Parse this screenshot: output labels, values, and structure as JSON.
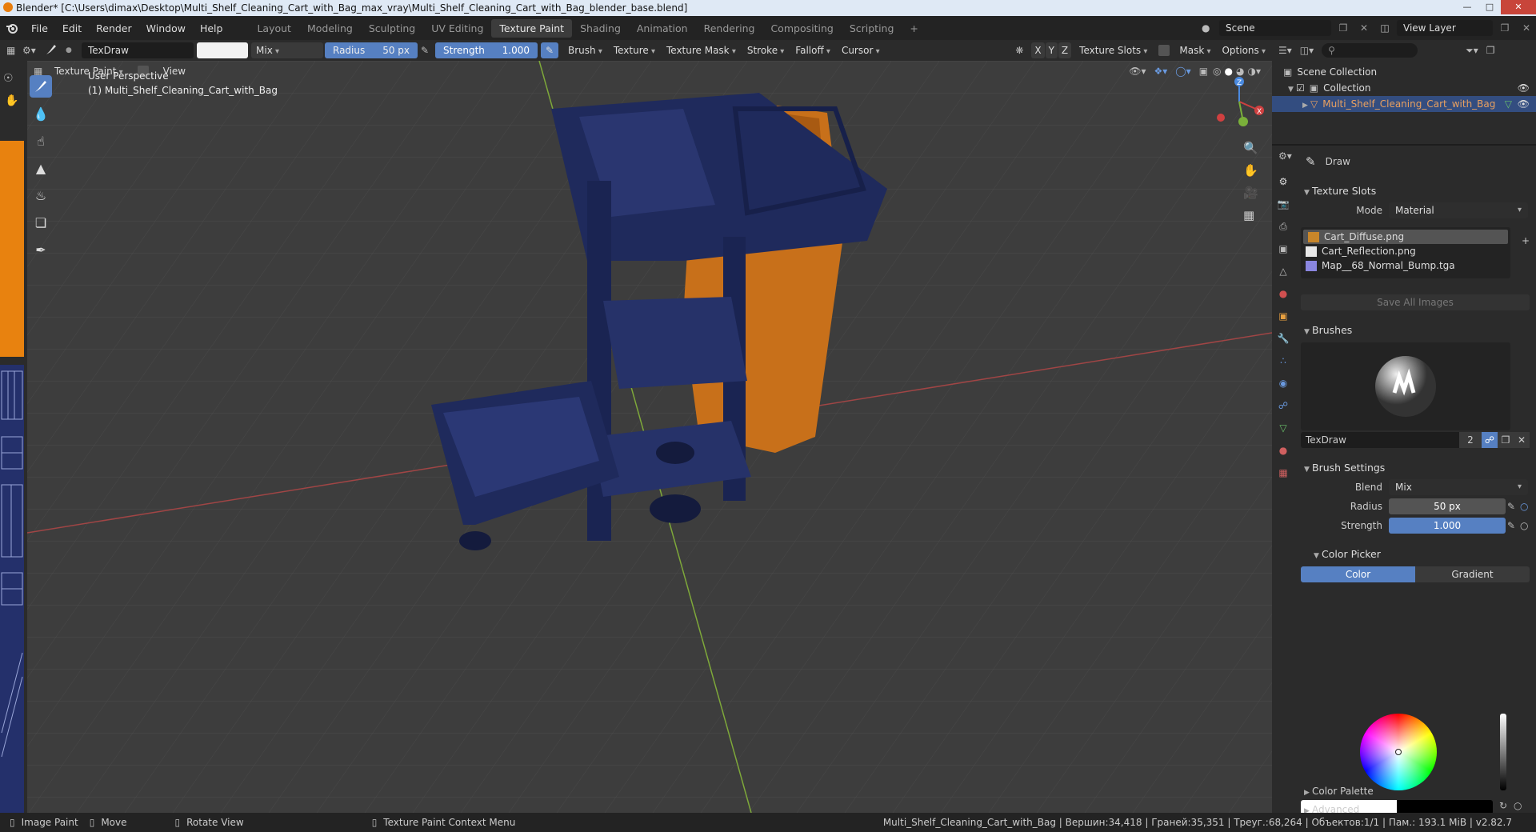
{
  "titlebar": {
    "title": "Blender* [C:\\Users\\dimax\\Desktop\\Multi_Shelf_Cleaning_Cart_with_Bag_max_vray\\Multi_Shelf_Cleaning_Cart_with_Bag_blender_base.blend]"
  },
  "menu": [
    "File",
    "Edit",
    "Render",
    "Window",
    "Help"
  ],
  "workspaces": [
    "Layout",
    "Modeling",
    "Sculpting",
    "UV Editing",
    "Texture Paint",
    "Shading",
    "Animation",
    "Rendering",
    "Compositing",
    "Scripting"
  ],
  "active_workspace": "Texture Paint",
  "scene": {
    "label": "Scene",
    "view_layer": "View Layer"
  },
  "header": {
    "brush_name": "TexDraw",
    "blend": "Mix",
    "radius_label": "Radius",
    "radius_value": "50 px",
    "strength_label": "Strength",
    "strength_value": "1.000",
    "strength_fraction": 1.0,
    "menus": [
      "Brush",
      "Texture",
      "Texture Mask",
      "Stroke",
      "Falloff",
      "Cursor"
    ],
    "axes": [
      "X",
      "Y",
      "Z"
    ],
    "texture_slots": "Texture Slots",
    "mask": "Mask",
    "options": "Options",
    "mode": "Texture Paint",
    "view": "View"
  },
  "viewport": {
    "perspective": "User Perspective",
    "object_label": "(1) Multi_Shelf_Cleaning_Cart_with_Bag"
  },
  "outliner": {
    "scene_collection": "Scene Collection",
    "collection": "Collection",
    "object": "Multi_Shelf_Cleaning_Cart_with_Bag"
  },
  "properties": {
    "tool_name": "Draw",
    "texture_slots_title": "Texture Slots",
    "mode_label": "Mode",
    "mode_value": "Material",
    "slots": [
      {
        "name": "Cart_Diffuse.png",
        "color": "#c8862a"
      },
      {
        "name": "Cart_Reflection.png",
        "color": "#e8e8e8"
      },
      {
        "name": "Map__68_Normal_Bump.tga",
        "color": "#8a86e0"
      }
    ],
    "save_all": "Save All Images",
    "brushes_title": "Brushes",
    "brush_name": "TexDraw",
    "brush_users": "2",
    "brush_settings_title": "Brush Settings",
    "blend_label": "Blend",
    "blend_value": "Mix",
    "radius_label": "Radius",
    "radius_value": "50 px",
    "strength_label": "Strength",
    "strength_value": "1.000",
    "color_picker_title": "Color Picker",
    "color_tab": "Color",
    "gradient_tab": "Gradient",
    "color_palette": "Color Palette",
    "advanced": "Advanced"
  },
  "statusbar": {
    "image_paint": "Image Paint",
    "move": "Move",
    "rotate": "Rotate View",
    "context": "Texture Paint Context Menu",
    "stats": "Multi_Shelf_Cleaning_Cart_with_Bag | Вершин:34,418 | Граней:35,351 | Треуг.:68,264 | Объектов:1/1 | Пам.: 193.1 MiB | v2.82.7"
  },
  "colors": {
    "accent": "#5680c2",
    "cart": "#1f2a5c",
    "bag": "#c8701a",
    "grid_x": "#b44a4a",
    "grid_y": "#7ea83a"
  },
  "icons": [
    "blender-logo-icon",
    "brush-icon",
    "eye-icon",
    "camera-icon",
    "hand-icon",
    "zoom-icon",
    "grid-icon"
  ]
}
